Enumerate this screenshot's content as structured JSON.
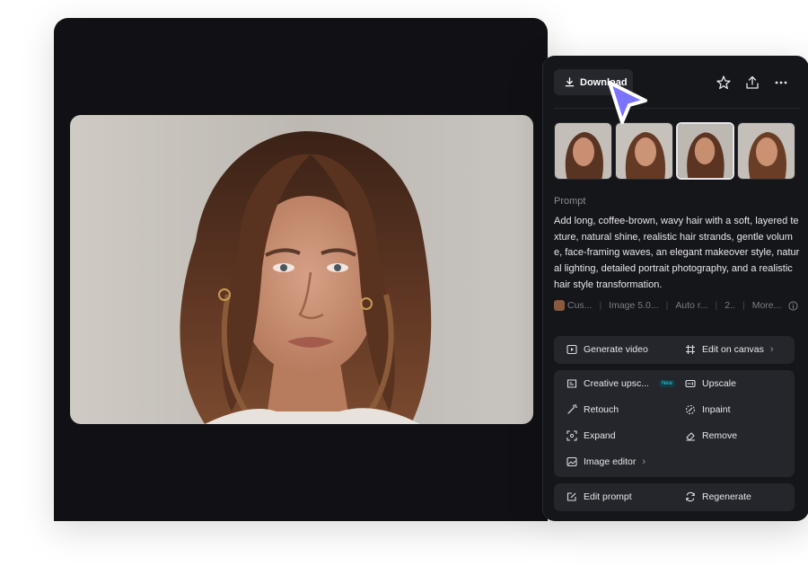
{
  "colors": {
    "panel_bg": "#15161a",
    "canvas_bg": "#111115",
    "card_bg": "#25262b",
    "cursor": "#7b73ff",
    "new_badge": "#20d3ee"
  },
  "toolbar": {
    "download_label": "Download",
    "icons": [
      "star-icon",
      "share-icon",
      "more-icon"
    ]
  },
  "thumbnails": {
    "count": 4,
    "selected_index": 2
  },
  "prompt": {
    "label": "Prompt",
    "text": "Add long, coffee-brown, wavy hair with a soft, layered texture, natural shine, realistic hair strands, gentle volume, face-framing waves, an elegant makeover style, natural lighting, detailed portrait photography, and a realistic hair style transformation."
  },
  "meta": {
    "style": "Cus...",
    "model": "Image 5.0...",
    "ratio": "Auto r...",
    "count": "2..",
    "more": "More..."
  },
  "actions": {
    "generate_video": "Generate video",
    "edit_on_canvas": "Edit on canvas",
    "creative_upscale": "Creative upsc...",
    "new_badge": "New",
    "upscale": "Upscale",
    "retouch": "Retouch",
    "inpaint": "Inpaint",
    "expand": "Expand",
    "remove": "Remove",
    "image_editor": "Image editor",
    "edit_prompt": "Edit prompt",
    "regenerate": "Regenerate"
  }
}
